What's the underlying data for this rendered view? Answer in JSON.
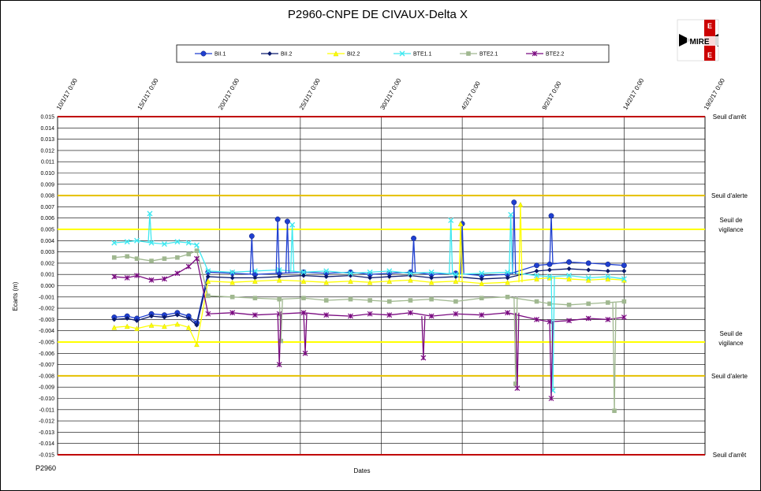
{
  "colors": {
    "seuil_arret": "#c00000",
    "seuil_alerte": "#e5c000",
    "seuil_vigilance": "#ffff00",
    "grid": "#000000",
    "logo_red": "#cc0000"
  },
  "logo": {
    "text": "MIRE",
    "alt_letters": [
      "E",
      "E",
      "E"
    ]
  },
  "footer": {
    "left_label": "P2960"
  },
  "chart_data": {
    "type": "line",
    "title": "P2960-CNPE DE CIVAUX-Delta X",
    "xlabel": "Dates",
    "ylabel": "Ecarts (m)",
    "ylim": [
      -0.015,
      0.015
    ],
    "ytick_step": 0.001,
    "yticks": [
      "0.015",
      "0.014",
      "0.013",
      "0.012",
      "0.011",
      "0.010",
      "0.009",
      "0.008",
      "0.007",
      "0.006",
      "0.005",
      "0.004",
      "0.003",
      "0.002",
      "0.001",
      "0.000",
      "-0.001",
      "-0.002",
      "-0.003",
      "-0.004",
      "-0.005",
      "-0.006",
      "-0.007",
      "-0.008",
      "-0.009",
      "-0.010",
      "-0.011",
      "-0.012",
      "-0.013",
      "-0.014",
      "-0.015"
    ],
    "xticks": [
      "10/1/17 0:00",
      "15/1/17 0:00",
      "20/1/17 0:00",
      "25/1/17 0:00",
      "30/1/17 0:00",
      "4/2/17 0:00",
      "9/2/17 0:00",
      "14/2/17 0:00",
      "19/2/17 0:00"
    ],
    "x_range_days": [
      0,
      40
    ],
    "xtick_days": [
      0,
      5,
      10,
      15,
      20,
      25,
      30,
      35,
      40
    ],
    "grid": true,
    "legend_position": "top",
    "thresholds": [
      {
        "label": "Seuil d'arrêt",
        "value": 0.015,
        "color": "#c00000"
      },
      {
        "label": "Seuil d'alerte",
        "value": 0.008,
        "color": "#e5c000"
      },
      {
        "label_lines": [
          "Seuil de",
          "vigilance"
        ],
        "value": 0.005,
        "color": "#ffff00"
      },
      {
        "label_lines": [
          "Seuil de",
          "vigilance"
        ],
        "value": -0.005,
        "color": "#ffff00"
      },
      {
        "label": "Seuil d'alerte",
        "value": -0.008,
        "color": "#e5c000"
      },
      {
        "label": "Seuil d'arrêt",
        "value": -0.015,
        "color": "#c00000"
      }
    ],
    "series": [
      {
        "name": "BII.1",
        "color": "#1f3fd0",
        "marker": "circle",
        "x": [
          3.5,
          4.3,
          4.9,
          5.8,
          6.6,
          7.4,
          8.1,
          8.6,
          9.3,
          10.8,
          12.2,
          13.7,
          15.2,
          16.6,
          18.1,
          19.3,
          20.5,
          21.8,
          23.1,
          24.6,
          26.2,
          27.8,
          29.6,
          30.4,
          31.6,
          32.8,
          34.0,
          35.0
        ],
        "y": [
          -0.0028,
          -0.0027,
          -0.0029,
          -0.0025,
          -0.0026,
          -0.0024,
          -0.0027,
          -0.0033,
          0.0012,
          0.0011,
          0.001,
          0.0011,
          0.0012,
          0.0011,
          0.0012,
          0.001,
          0.0011,
          0.0012,
          0.001,
          0.0011,
          0.0009,
          0.001,
          0.0018,
          0.0019,
          0.0021,
          0.002,
          0.0019,
          0.0018
        ]
      },
      {
        "name": "BII.2",
        "color": "#0a1a6e",
        "marker": "diamond",
        "x": [
          3.5,
          4.3,
          4.9,
          5.8,
          6.6,
          7.4,
          8.1,
          8.6,
          9.3,
          10.8,
          12.2,
          13.7,
          15.2,
          16.6,
          18.1,
          19.3,
          20.5,
          21.8,
          23.1,
          24.6,
          26.2,
          27.8,
          29.6,
          30.4,
          31.6,
          32.8,
          34.0,
          35.0
        ],
        "y": [
          -0.003,
          -0.0029,
          -0.0031,
          -0.0027,
          -0.0028,
          -0.0026,
          -0.0029,
          -0.0035,
          0.0008,
          0.0007,
          0.0007,
          0.0008,
          0.0009,
          0.0008,
          0.0009,
          0.0007,
          0.0008,
          0.0009,
          0.0007,
          0.0008,
          0.0006,
          0.0007,
          0.0013,
          0.0014,
          0.0015,
          0.0014,
          0.0013,
          0.0013
        ]
      },
      {
        "name": "BI2.2",
        "color": "#ffff00",
        "marker": "triangle",
        "x": [
          3.5,
          4.3,
          4.9,
          5.8,
          6.6,
          7.4,
          8.1,
          8.6,
          9.3,
          10.8,
          12.2,
          13.7,
          15.2,
          16.6,
          18.1,
          19.3,
          20.5,
          21.8,
          23.1,
          24.6,
          26.2,
          27.8,
          29.6,
          30.4,
          31.6,
          32.8,
          34.0,
          35.0
        ],
        "y": [
          -0.0037,
          -0.0036,
          -0.0038,
          -0.0035,
          -0.0036,
          -0.0034,
          -0.0037,
          -0.0052,
          0.0004,
          0.0003,
          0.0004,
          0.0005,
          0.0004,
          0.0003,
          0.0004,
          0.0003,
          0.0004,
          0.0005,
          0.0003,
          0.0004,
          0.0002,
          0.0003,
          0.0006,
          0.0007,
          0.0006,
          0.0005,
          0.0006,
          0.0005
        ]
      },
      {
        "name": "BTE1.1",
        "color": "#40e8f0",
        "marker": "x",
        "x": [
          3.5,
          4.3,
          4.9,
          5.8,
          6.6,
          7.4,
          8.1,
          8.6,
          9.3,
          10.8,
          12.2,
          13.7,
          15.2,
          16.6,
          18.1,
          19.3,
          20.5,
          21.8,
          23.1,
          24.6,
          26.2,
          27.8,
          29.6,
          30.4,
          31.6,
          32.8,
          34.0,
          35.0
        ],
        "y": [
          0.0038,
          0.0039,
          0.004,
          0.0038,
          0.0037,
          0.0039,
          0.0038,
          0.0036,
          0.0013,
          0.0012,
          0.0013,
          0.0014,
          0.0012,
          0.0013,
          0.0011,
          0.0012,
          0.0013,
          0.0011,
          0.0012,
          0.001,
          0.0011,
          0.0012,
          0.0009,
          0.0008,
          0.0009,
          0.0007,
          0.0008,
          0.0006
        ]
      },
      {
        "name": "BTE2.1",
        "color": "#a0b890",
        "marker": "square",
        "x": [
          3.5,
          4.3,
          4.9,
          5.8,
          6.6,
          7.4,
          8.1,
          8.6,
          9.3,
          10.8,
          12.2,
          13.7,
          15.2,
          16.6,
          18.1,
          19.3,
          20.5,
          21.8,
          23.1,
          24.6,
          26.2,
          27.8,
          29.6,
          30.4,
          31.6,
          32.8,
          34.0,
          35.0
        ],
        "y": [
          0.0025,
          0.0026,
          0.0024,
          0.0022,
          0.0024,
          0.0025,
          0.0028,
          0.0031,
          -0.0009,
          -0.001,
          -0.0011,
          -0.0012,
          -0.0011,
          -0.0013,
          -0.0012,
          -0.0013,
          -0.0014,
          -0.0013,
          -0.0012,
          -0.0014,
          -0.0011,
          -0.001,
          -0.0014,
          -0.0016,
          -0.0017,
          -0.0016,
          -0.0015,
          -0.0014
        ]
      },
      {
        "name": "BTE2.2",
        "color": "#7a0a80",
        "marker": "star",
        "x": [
          3.5,
          4.3,
          4.9,
          5.8,
          6.6,
          7.4,
          8.1,
          8.6,
          9.3,
          10.8,
          12.2,
          13.7,
          15.2,
          16.6,
          18.1,
          19.3,
          20.5,
          21.8,
          23.1,
          24.6,
          26.2,
          27.8,
          29.6,
          30.4,
          31.6,
          32.8,
          34.0,
          35.0
        ],
        "y": [
          0.0008,
          0.0007,
          0.0009,
          0.0005,
          0.0006,
          0.0011,
          0.0017,
          0.0024,
          -0.0025,
          -0.0024,
          -0.0026,
          -0.0025,
          -0.0024,
          -0.0026,
          -0.0027,
          -0.0025,
          -0.0026,
          -0.0024,
          -0.0027,
          -0.0025,
          -0.0026,
          -0.0024,
          -0.003,
          -0.0032,
          -0.0031,
          -0.0029,
          -0.003,
          -0.0028
        ]
      }
    ],
    "spikes": [
      {
        "series": "BII.1",
        "x": 13.6,
        "y": 0.0059
      },
      {
        "series": "BII.1",
        "x": 14.2,
        "y": 0.0057
      },
      {
        "series": "BII.1",
        "x": 12.0,
        "y": 0.0044
      },
      {
        "series": "BII.1",
        "x": 28.2,
        "y": 0.0074
      },
      {
        "series": "BII.1",
        "x": 30.5,
        "y": 0.0062
      },
      {
        "series": "BII.1",
        "x": 25.0,
        "y": 0.0055
      },
      {
        "series": "BII.1",
        "x": 22.0,
        "y": 0.0042
      },
      {
        "series": "BI2.2",
        "x": 28.6,
        "y": 0.0072
      },
      {
        "series": "BI2.2",
        "x": 24.9,
        "y": 0.0055
      },
      {
        "series": "BTE1.1",
        "x": 5.7,
        "y": 0.0064
      },
      {
        "series": "BTE1.1",
        "x": 14.5,
        "y": 0.0054
      },
      {
        "series": "BTE1.1",
        "x": 24.3,
        "y": 0.0058
      },
      {
        "series": "BTE1.1",
        "x": 28.0,
        "y": 0.0063
      },
      {
        "series": "BTE1.1",
        "x": 30.6,
        "y": -0.0093
      },
      {
        "series": "BTE2.1",
        "x": 34.4,
        "y": -0.0111
      },
      {
        "series": "BTE2.1",
        "x": 13.8,
        "y": -0.0049
      },
      {
        "series": "BTE2.1",
        "x": 28.3,
        "y": -0.0087
      },
      {
        "series": "BTE2.2",
        "x": 13.7,
        "y": -0.007
      },
      {
        "series": "BTE2.2",
        "x": 28.4,
        "y": -0.0091
      },
      {
        "series": "BTE2.2",
        "x": 30.5,
        "y": -0.01
      },
      {
        "series": "BTE2.2",
        "x": 15.3,
        "y": -0.006
      },
      {
        "series": "BTE2.2",
        "x": 22.6,
        "y": -0.0064
      }
    ]
  }
}
